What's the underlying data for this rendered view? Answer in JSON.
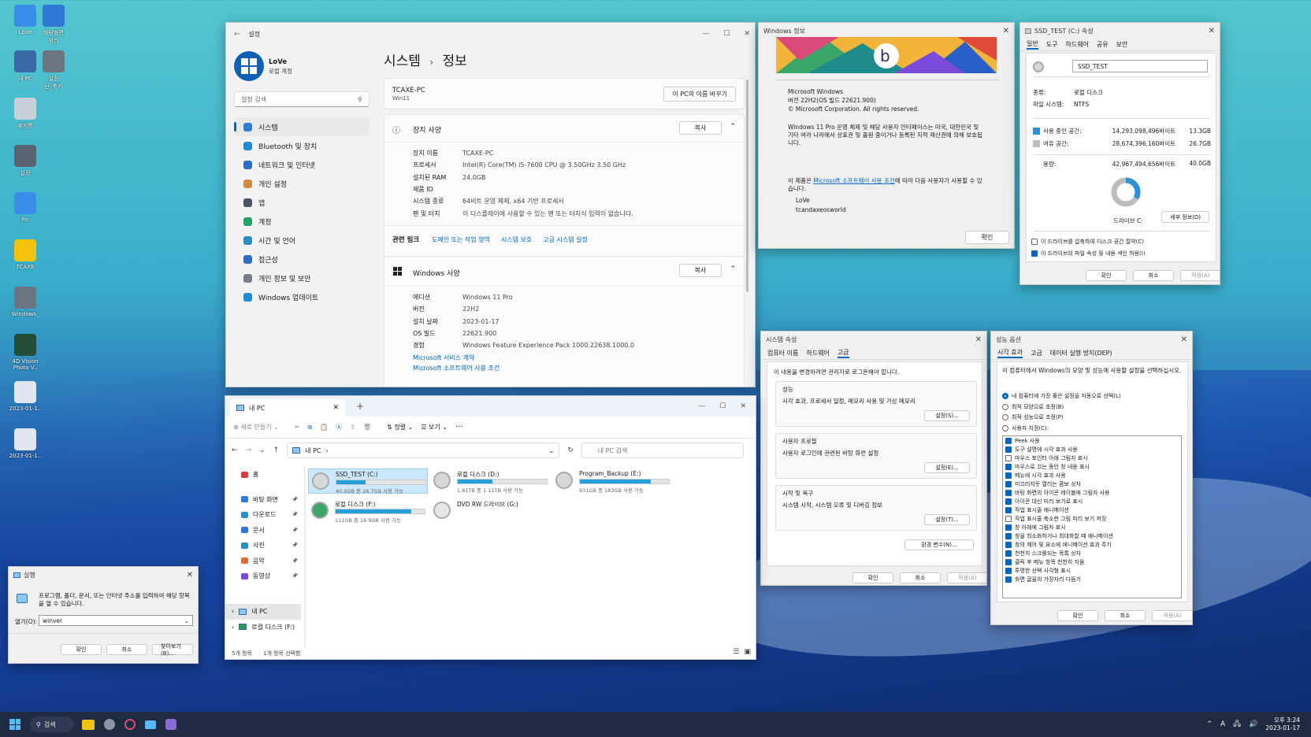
{
  "desktop": {
    "icons": [
      {
        "label": "LoVe",
        "color": "#3b8ee8"
      },
      {
        "label": "바탕화면\n정리",
        "color": "#2f78d8"
      },
      {
        "label": "내 PC",
        "color": "#3a6aa6"
      },
      {
        "label": "설정\n단_축키",
        "color": "#6b7580"
      },
      {
        "label": "휴지통",
        "color": "#c8d0d8"
      },
      {
        "label": "설정",
        "color": "#5a6470"
      },
      {
        "label": "Pic",
        "color": "#3b8ee8"
      },
      {
        "label": "TCAXE",
        "color": "#f2c20c"
      },
      {
        "label": "Windows_",
        "color": "#6b7580"
      },
      {
        "label": "4D Vision\nPhoto V..",
        "color": "#244d3a"
      },
      {
        "label": "2023-01-1..",
        "color": "#dfe6ee"
      },
      {
        "label": "2023-01-1..",
        "color": "#dfe6ee"
      }
    ]
  },
  "settings": {
    "title": "설정",
    "user_name": "LoVe",
    "user_sub": "로컬 계정",
    "search_placeholder": "설정 검색",
    "nav": [
      {
        "label": "시스템",
        "color": "#2d7fd3"
      },
      {
        "label": "Bluetooth 및 장치",
        "color": "#1f8bde"
      },
      {
        "label": "네트워크 및 인터넷",
        "color": "#2a6ec9"
      },
      {
        "label": "개인 설정",
        "color": "#d48b3a"
      },
      {
        "label": "앱",
        "color": "#4b5563"
      },
      {
        "label": "계정",
        "color": "#22a566"
      },
      {
        "label": "시간 및 언어",
        "color": "#2a8ec9"
      },
      {
        "label": "접근성",
        "color": "#2a6ec9"
      },
      {
        "label": "개인 정보 및 보안",
        "color": "#7a7f86"
      },
      {
        "label": "Windows 업데이트",
        "color": "#1f8bde"
      }
    ],
    "breadcrumb_parent": "시스템",
    "breadcrumb_sep": "›",
    "breadcrumb_current": "정보",
    "pc_name": "TCAXE-PC",
    "pc_sub": "Win11",
    "rename_button": "이 PC의 이름 바꾸기",
    "device_spec_title": "장치 사양",
    "copy_label": "복사",
    "device_specs": [
      {
        "k": "장치 이름",
        "v": "TCAXE-PC"
      },
      {
        "k": "프로세서",
        "v": "Intel(R) Core(TM) i5-7600 CPU @ 3.50GHz   3.50 GHz"
      },
      {
        "k": "설치된 RAM",
        "v": "24.0GB"
      },
      {
        "k": "제품 ID",
        "v": ""
      },
      {
        "k": "시스템 종류",
        "v": "64비트 운영 체제, x64 기반 프로세서"
      },
      {
        "k": "펜 및 터치",
        "v": "이 디스플레이에 사용할 수 있는 펜 또는 터치식 입력이 없습니다."
      }
    ],
    "related_label": "관련 링크",
    "related_links": [
      "도메인 또는 작업 영역",
      "시스템 보호",
      "고급 시스템 설정"
    ],
    "win_spec_title": "Windows 사양",
    "win_specs": [
      {
        "k": "에디션",
        "v": "Windows 11 Pro"
      },
      {
        "k": "버전",
        "v": "22H2"
      },
      {
        "k": "설치 날짜",
        "v": "2023-01-17"
      },
      {
        "k": "OS 빌드",
        "v": "22621.900"
      },
      {
        "k": "경험",
        "v": "Windows Feature Experience Pack 1000.22638.1000.0"
      }
    ],
    "ms_links": [
      "Microsoft 서비스 계약",
      "Microsoft 소프트웨어 사용 조건"
    ]
  },
  "winver": {
    "title": "Windows 정보",
    "line1": "Microsoft Windows",
    "line2": "버전 22H2(OS 빌드 22621.900)",
    "line3": "© Microsoft Corporation. All rights reserved.",
    "para": "Windows 11 Pro 운영 체제 및 해당 사용자 인터페이스는 미국, 대한민국 및 기타 여러 나라에서 상표권 및 출원 중이거나 등록된 지적 재산권에 의해 보호됩니다.",
    "license_pre": "이 제품은 ",
    "license_link": "Microsoft 소프트웨어 사용 조건",
    "license_post": "에 따라 다음 사용자가 사용할 수 있습니다.",
    "user1": "LoVe",
    "user2": "tcandaxeosworld",
    "ok": "확인"
  },
  "drive_props": {
    "title": "SSD_TEST (C:) 속성",
    "tabs": [
      "일반",
      "도구",
      "하드웨어",
      "공유",
      "보안"
    ],
    "name_value": "SSD_TEST",
    "type_label": "종류:",
    "type_value": "로컬 디스크",
    "fs_label": "파일 시스템:",
    "fs_value": "NTFS",
    "used_label": "사용 중인 공간:",
    "used_bytes": "14,293,098,496바이트",
    "used_gb": "13.3GB",
    "used_color": "#2f8fd8",
    "free_label": "여유 공간:",
    "free_bytes": "28,674,396,160바이트",
    "free_gb": "26.7GB",
    "free_color": "#bdbdbd",
    "cap_label": "용량:",
    "cap_bytes": "42,967,494,656바이트",
    "cap_gb": "40.0GB",
    "used_fraction": 0.333,
    "drive_label": "드라이브 C:",
    "cleanup_button": "세부 정보(D)",
    "compress_label": "이 드라이브를 압축하여 디스크 공간 절약(C)",
    "index_label": "이 드라이브의 파일 속성 및 내용 색인 허용(I)",
    "ok": "확인",
    "cancel": "취소",
    "apply": "적용(A)"
  },
  "sysprops": {
    "title": "시스템 속성",
    "tabs": [
      "컴퓨터 이름",
      "하드웨어",
      "고급"
    ],
    "admin_note": "이 내용을 변경하려면 관리자로 로그온해야 합니다.",
    "perf_title": "성능",
    "perf_desc": "시각 효과, 프로세서 일정, 메모리 사용 및 가상 메모리",
    "perf_btn": "설정(S)...",
    "profile_title": "사용자 프로필",
    "profile_desc": "사용자 로그인에 관련된 바탕 화면 설정",
    "profile_btn": "설정(E)...",
    "startup_title": "시작 및 복구",
    "startup_desc": "시스템 시작, 시스템 오류 및 디버깅 정보",
    "startup_btn": "설정(T)...",
    "env_btn": "환경 변수(N)...",
    "ok": "확인",
    "cancel": "취소",
    "apply": "적용(A)"
  },
  "perf": {
    "title": "성능 옵션",
    "tabs": [
      "시각 효과",
      "고급",
      "데이터 실행 방지(DEP)"
    ],
    "desc": "이 컴퓨터에서 Windows의 모양 및 성능에 사용할 설정을 선택하십시오.",
    "radios": [
      {
        "label": "내 컴퓨터에 가장 좋은 설정을 자동으로 선택(L)",
        "on": true
      },
      {
        "label": "최적 모양으로 조정(B)",
        "on": false
      },
      {
        "label": "최적 성능으로 조정(P)",
        "on": false
      },
      {
        "label": "사용자 지정(C):",
        "on": false
      }
    ],
    "checks": [
      {
        "label": "Peek 사용",
        "on": true
      },
      {
        "label": "도구 설명에 시각 효과 사용",
        "on": true
      },
      {
        "label": "마우스 포인터 아래 그림자 표시",
        "on": false
      },
      {
        "label": "마우스로 끄는 동안 창 내용 표시",
        "on": true
      },
      {
        "label": "메뉴에 시각 효과 사용",
        "on": true
      },
      {
        "label": "미끄러지듯 열리는 콤보 상자",
        "on": true
      },
      {
        "label": "바탕 화면의 아이콘 레이블에 그림자 사용",
        "on": true
      },
      {
        "label": "아이콘 대신 미리 보기로 표시",
        "on": true
      },
      {
        "label": "작업 표시줄 애니메이션",
        "on": true
      },
      {
        "label": "작업 표시줄 축소판 그림 미리 보기 저장",
        "on": false
      },
      {
        "label": "창 아래에 그림자 표시",
        "on": true
      },
      {
        "label": "창을 최소화하거나 최대화할 때 애니메이션",
        "on": true
      },
      {
        "label": "창의 제어 및 요소에 애니메이션 효과 주기",
        "on": true
      },
      {
        "label": "천천히 스크롤되는 목록 상자",
        "on": true
      },
      {
        "label": "클릭 후 메뉴 항목 천천히 지움",
        "on": true
      },
      {
        "label": "투명한 선택 사각형 표시",
        "on": true
      },
      {
        "label": "화면 글꼴의 가장자리 다듬기",
        "on": true
      }
    ],
    "ok": "확인",
    "cancel": "취소",
    "apply": "적용(A)"
  },
  "explorer": {
    "tab_title": "내 PC",
    "new_tab": "+",
    "toolbar": {
      "new": "새로 만들기",
      "sort": "정렬",
      "view": "보기",
      "more": "···"
    },
    "address": "내 PC",
    "address_sep": "›",
    "search_placeholder": "내 PC 검색",
    "nav": [
      {
        "label": "홈",
        "color": "#d83b3b",
        "pin": ""
      },
      {
        "label": "바탕 화면",
        "color": "#2f78d8",
        "pin": "📌"
      },
      {
        "label": "다운로드",
        "color": "#2a8ec9",
        "pin": "📌"
      },
      {
        "label": "문서",
        "color": "#2f78d8",
        "pin": "📌"
      },
      {
        "label": "사진",
        "color": "#2a8ec9",
        "pin": "📌"
      },
      {
        "label": "음악",
        "color": "#e06c3c",
        "pin": "📌"
      },
      {
        "label": "동영상",
        "color": "#7a4ad8",
        "pin": "📌"
      }
    ],
    "tree": [
      {
        "label": "내 PC"
      },
      {
        "label": "로컬 디스크 (F:)"
      }
    ],
    "drives": [
      {
        "name": "SSD_TEST (C:)",
        "info": "40.0GB 중 26.7GB 사용 가능",
        "fill": 0.33
      },
      {
        "name": "로컬 디스크 (D:)",
        "info": "1.81TB 중 1.11TB 사용 가능",
        "fill": 0.39
      },
      {
        "name": "Program_Backup (E:)",
        "info": "931GB 중 183GB 사용 가능",
        "fill": 0.8
      },
      {
        "name": "로컬 디스크 (F:)",
        "info": "111GB 중 16.9GB 사용 가능",
        "fill": 0.85
      }
    ],
    "dvd": "DVD RW 드라이브 (G:)",
    "status_count": "5개 항목",
    "status_sel": "1개 항목 선택함"
  },
  "run": {
    "title": "실행",
    "desc": "프로그램, 폴더, 문서, 또는 인터넷 주소를 입력하여 해당 항목을 열 수 있습니다.",
    "open_label": "열기(O):",
    "value": "winver",
    "ok": "확인",
    "cancel": "취소",
    "browse": "찾아보기(B)..."
  },
  "taskbar": {
    "search": "검색",
    "time": "오후 3:24",
    "date": "2023-01-17",
    "lang": "A"
  }
}
